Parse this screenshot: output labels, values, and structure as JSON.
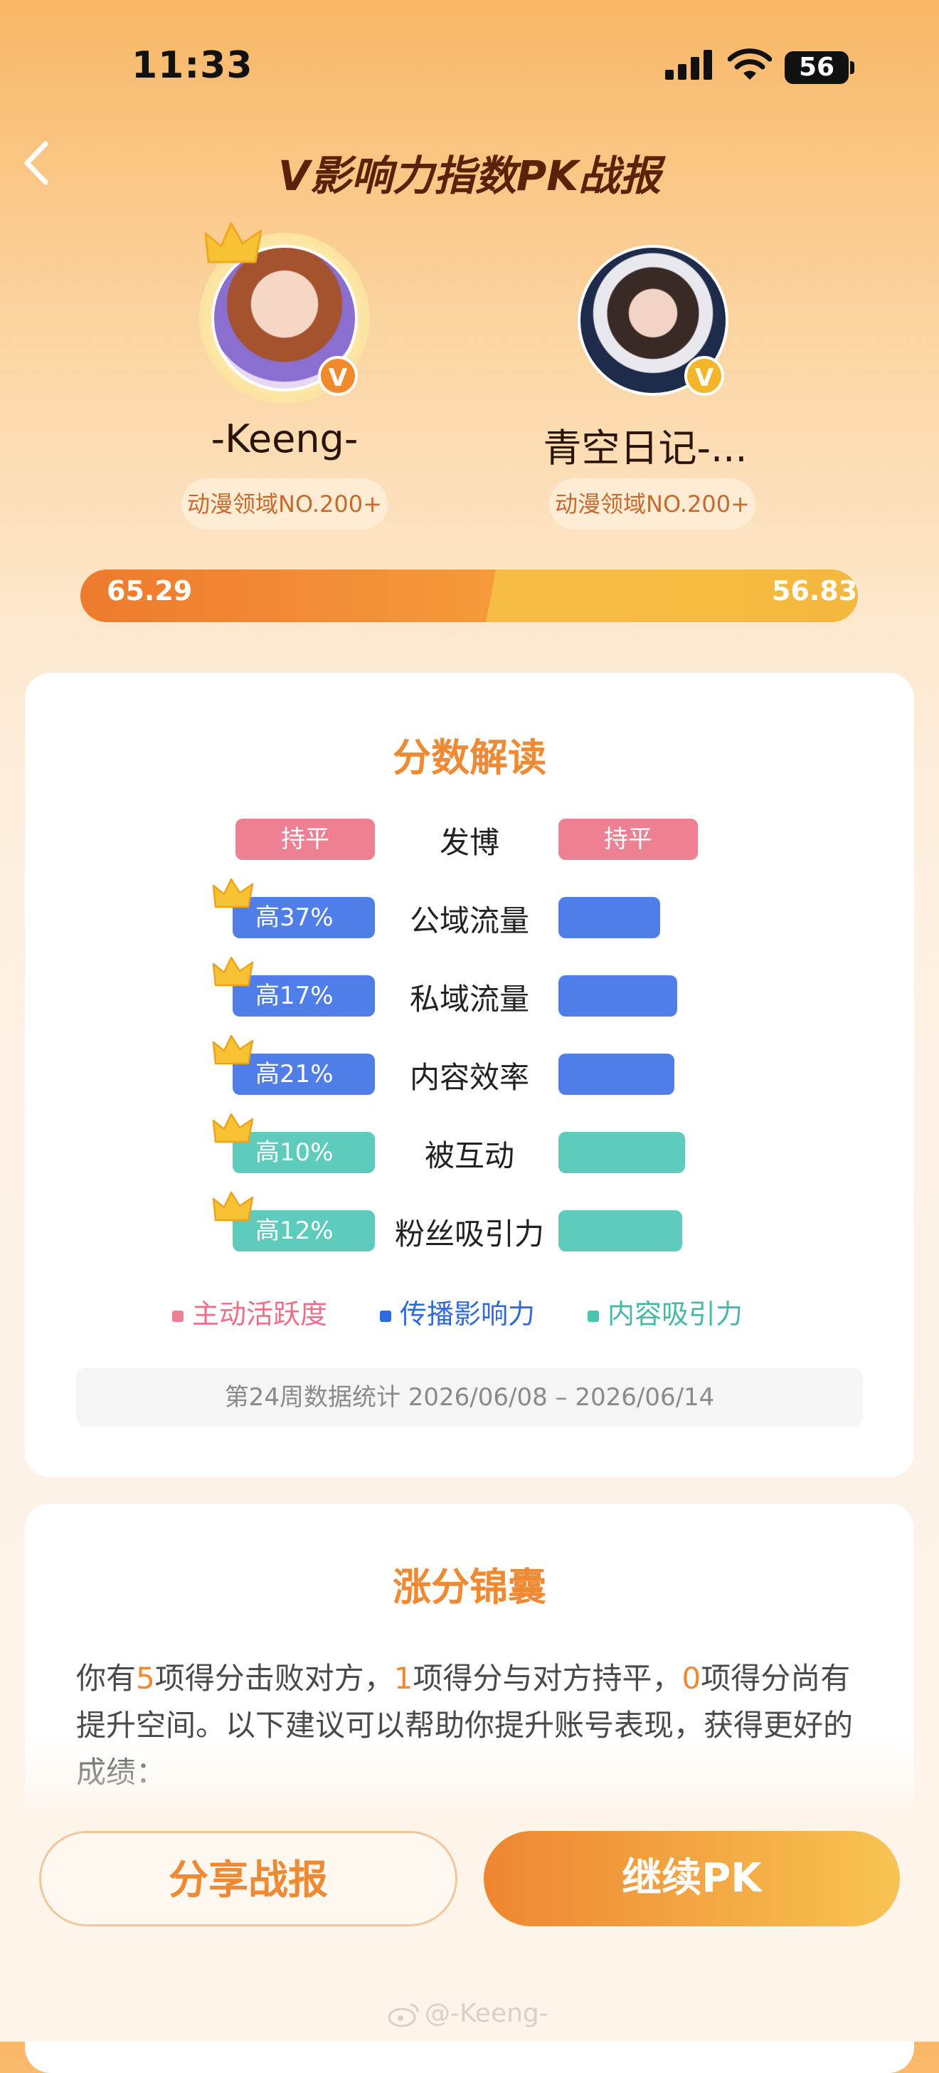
{
  "status_bar": {
    "time": "11:33",
    "battery": "56"
  },
  "header": {
    "title": "V影响力指数PK战报"
  },
  "players": [
    {
      "name": "-Keeng-",
      "rank": "动漫领域NO.200+",
      "score": "65.29",
      "score_value": 65.29
    },
    {
      "name": "青空日记-...",
      "rank": "动漫领域NO.200+",
      "score": "56.83",
      "score_value": 56.83
    }
  ],
  "score_section": {
    "title": "分数解读",
    "rows": [
      {
        "label": "发博",
        "left_text": "持平",
        "right_text": "持平",
        "category": "主动活跃度",
        "color": "#ee8094",
        "left_fill": 1.0,
        "right_fill": 1.0,
        "winner": false
      },
      {
        "label": "公域流量",
        "left_text": "高37%",
        "right_text": "",
        "category": "传播影响力",
        "color": "#4f7ee8",
        "left_fill": 1.0,
        "right_fill": 0.73,
        "winner": true
      },
      {
        "label": "私域流量",
        "left_text": "高17%",
        "right_text": "",
        "category": "传播影响力",
        "color": "#4f7ee8",
        "left_fill": 1.0,
        "right_fill": 0.85,
        "winner": true
      },
      {
        "label": "内容效率",
        "left_text": "高21%",
        "right_text": "",
        "category": "传播影响力",
        "color": "#4f7ee8",
        "left_fill": 1.0,
        "right_fill": 0.83,
        "winner": true
      },
      {
        "label": "被互动",
        "left_text": "高10%",
        "right_text": "",
        "category": "内容吸引力",
        "color": "#5fcbbd",
        "left_fill": 1.0,
        "right_fill": 0.91,
        "winner": true
      },
      {
        "label": "粉丝吸引力",
        "left_text": "高12%",
        "right_text": "",
        "category": "内容吸引力",
        "color": "#5fcbbd",
        "left_fill": 1.0,
        "right_fill": 0.89,
        "winner": true
      }
    ],
    "legend": [
      {
        "label": "主动活跃度",
        "color": "#ee8094"
      },
      {
        "label": "传播影响力",
        "color": "#2f6ae0"
      },
      {
        "label": "内容吸引力",
        "color": "#4fc3b3"
      }
    ],
    "period": "第24周数据统计 2026/06/08 – 2026/06/14"
  },
  "tips_section": {
    "title": "涨分锦囊",
    "p1": "你有",
    "n1": "5",
    "p2": "项得分击败对方，",
    "n2": "1",
    "p3": "项得分与对方持平，",
    "n3": "0",
    "p4": "项得分尚有提升空间。以下建议可以帮助你提升账号表现，获得更好的成绩："
  },
  "buttons": {
    "share": "分享战报",
    "continue": "继续PK"
  },
  "watermark": "@-Keeng-"
}
